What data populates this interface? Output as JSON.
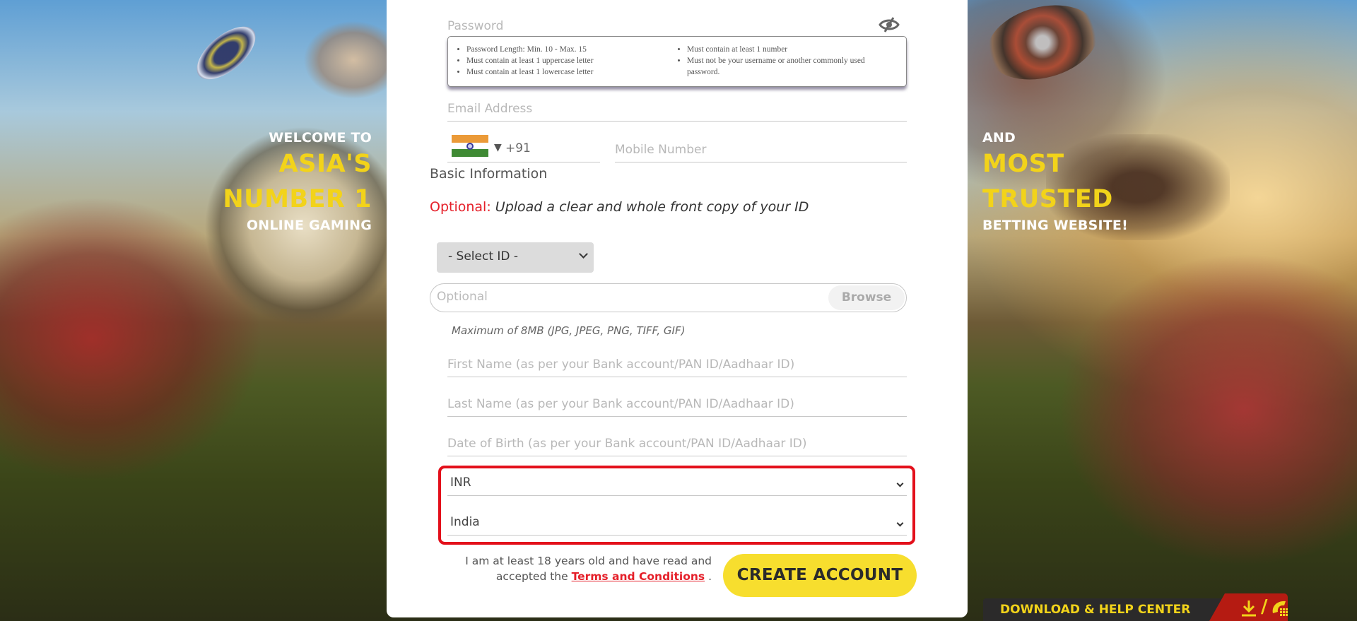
{
  "hero": {
    "left": {
      "line1": "WELCOME TO",
      "line2": "ASIA'S",
      "line3": "NUMBER 1",
      "line4": "ONLINE GAMING"
    },
    "right": {
      "line1": "AND",
      "line2": "MOST",
      "line3": "TRUSTED",
      "line4": "BETTING WEBSITE!"
    }
  },
  "form": {
    "password": {
      "placeholder": "Password",
      "icon": "eye-slash-icon"
    },
    "password_rules": {
      "col1": [
        "Password Length: Min. 10 - Max. 15",
        "Must contain at least 1 uppercase letter",
        "Must contain at least 1 lowercase letter"
      ],
      "col2": [
        "Must contain at least 1 number",
        "Must not be your username or another commonly used password."
      ]
    },
    "email": {
      "placeholder": "Email Address"
    },
    "phone": {
      "country_flag": "india-flag-icon",
      "code": "+91",
      "placeholder": "Mobile Number"
    },
    "basic_info_title": "Basic Information",
    "upload": {
      "optional_label": "Optional:",
      "message": "Upload a clear and whole front copy of your ID",
      "id_select": "- Select ID -",
      "file_placeholder": "Optional",
      "browse_label": "Browse",
      "max_note": "Maximum of 8MB (JPG, JPEG, PNG, TIFF, GIF)"
    },
    "first_name": {
      "placeholder": "First Name (as per your Bank account/PAN ID/Aadhaar ID)"
    },
    "last_name": {
      "placeholder": "Last Name (as per your Bank account/PAN ID/Aadhaar ID)"
    },
    "dob": {
      "placeholder": "Date of Birth (as per your Bank account/PAN ID/Aadhaar ID)"
    },
    "currency": {
      "value": "INR"
    },
    "country": {
      "value": "India"
    },
    "terms": {
      "line1": "I am at least 18 years old and have read and",
      "line2_prefix": "accepted the",
      "link": "Terms and Conditions",
      "suffix": "."
    },
    "create_button": "CREATE ACCOUNT"
  },
  "help_center": {
    "label": "DOWNLOAD & HELP CENTER",
    "separator": "/"
  },
  "colors": {
    "accent_yellow": "#f7de2e",
    "highlight_red": "#e3101b",
    "optional_red": "#e5202a",
    "help_red": "#b51b12"
  }
}
